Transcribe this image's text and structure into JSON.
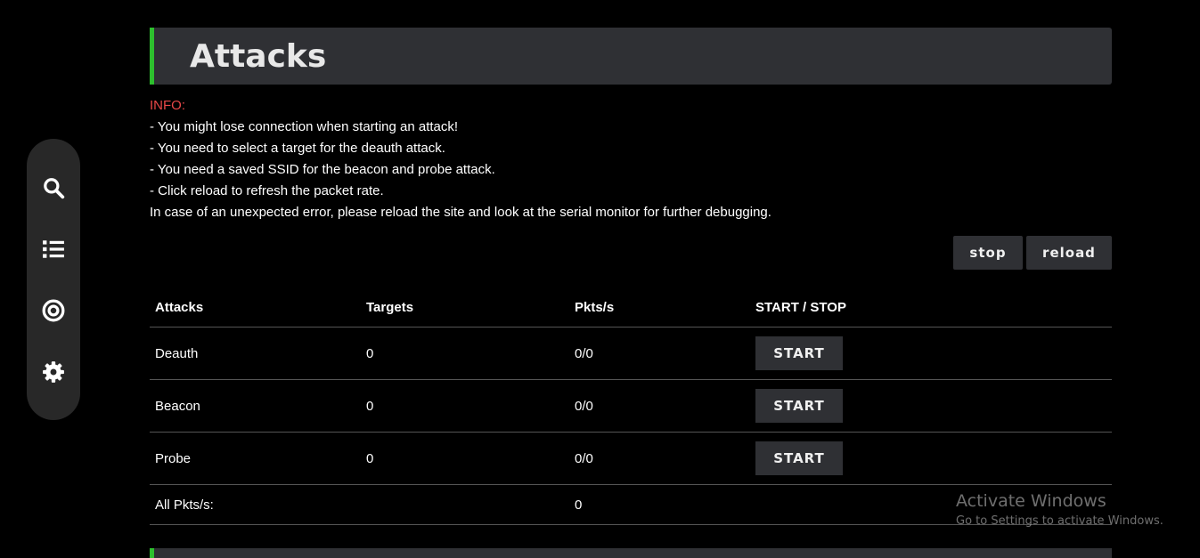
{
  "sidebar": {
    "items": [
      {
        "icon": "search-icon"
      },
      {
        "icon": "list-icon"
      },
      {
        "icon": "target-icon"
      },
      {
        "icon": "gear-icon"
      }
    ]
  },
  "header": {
    "title": "Attacks"
  },
  "info": {
    "title": "INFO:",
    "lines": [
      "- You might lose connection when starting an attack!",
      "- You need to select a target for the deauth attack.",
      "- You need a saved SSID for the beacon and probe attack.",
      "- Click reload to refresh the packet rate.",
      "In case of an unexpected error, please reload the site and look at the serial monitor for further debugging."
    ]
  },
  "controls": {
    "stop_label": "stop",
    "reload_label": "reload"
  },
  "table": {
    "headers": [
      "Attacks",
      "Targets",
      "Pkts/s",
      "START / STOP"
    ],
    "rows": [
      {
        "name": "Deauth",
        "targets": "0",
        "pkts": "0/0",
        "action": "START"
      },
      {
        "name": "Beacon",
        "targets": "0",
        "pkts": "0/0",
        "action": "START"
      },
      {
        "name": "Probe",
        "targets": "0",
        "pkts": "0/0",
        "action": "START"
      }
    ],
    "total_label": "All Pkts/s:",
    "total_value": "0"
  },
  "watermark": {
    "line1": "Activate Windows",
    "line2": "Go to Settings to activate Windows."
  },
  "colors": {
    "accent": "#2dbf2d",
    "info": "#e94848",
    "panel": "#2f3034"
  }
}
